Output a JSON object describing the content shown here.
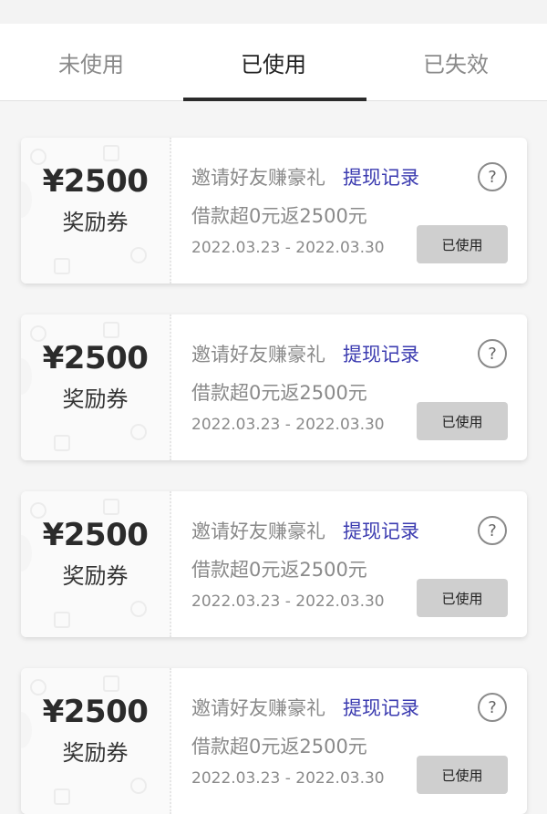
{
  "tabs": [
    {
      "label": "未使用"
    },
    {
      "label": "已使用"
    },
    {
      "label": "已失效"
    }
  ],
  "coupons": [
    {
      "amount": "¥2500",
      "type_label": "奖励券",
      "title": "邀请好友赚豪礼",
      "link_label": "提现记录",
      "description": "借款超0元返2500元",
      "date_range": "2022.03.23 - 2022.03.30",
      "status_label": "已使用",
      "help_icon": "?"
    },
    {
      "amount": "¥2500",
      "type_label": "奖励券",
      "title": "邀请好友赚豪礼",
      "link_label": "提现记录",
      "description": "借款超0元返2500元",
      "date_range": "2022.03.23 - 2022.03.30",
      "status_label": "已使用",
      "help_icon": "?"
    },
    {
      "amount": "¥2500",
      "type_label": "奖励券",
      "title": "邀请好友赚豪礼",
      "link_label": "提现记录",
      "description": "借款超0元返2500元",
      "date_range": "2022.03.23 - 2022.03.30",
      "status_label": "已使用",
      "help_icon": "?"
    },
    {
      "amount": "¥2500",
      "type_label": "奖励券",
      "title": "邀请好友赚豪礼",
      "link_label": "提现记录",
      "description": "借款超0元返2500元",
      "date_range": "2022.03.23 - 2022.03.30",
      "status_label": "已使用",
      "help_icon": "?"
    }
  ],
  "colors": {
    "link": "#3b3bb0",
    "muted_text": "#8a8a8a",
    "status_button_bg": "#cfcfcf",
    "active_tab_underline": "#2b2b2b"
  }
}
